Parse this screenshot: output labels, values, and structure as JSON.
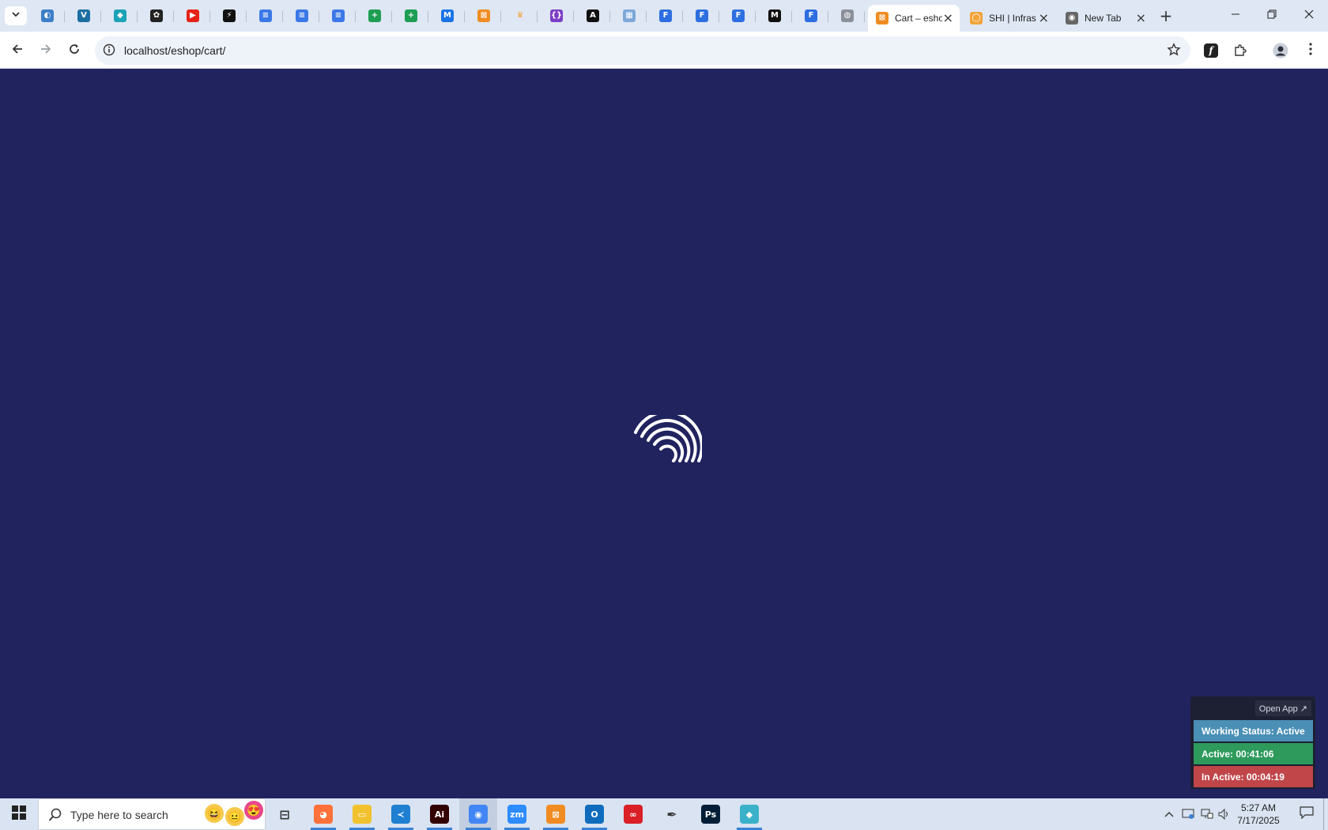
{
  "browser": {
    "pinned_tabs": [
      {
        "icon": "globe-blue-icon",
        "color": "#3d7fc7",
        "glyph": "◐"
      },
      {
        "icon": "shield-v-icon",
        "color": "#1d6fa3",
        "glyph": "V"
      },
      {
        "icon": "cube-teal-icon",
        "color": "#1aa3b5",
        "glyph": "◆"
      },
      {
        "icon": "openai-icon",
        "color": "#222222",
        "glyph": "✿"
      },
      {
        "icon": "youtube-icon",
        "color": "#e62117",
        "glyph": "▶"
      },
      {
        "icon": "bolt-icon",
        "color": "#111111",
        "glyph": "⚡"
      },
      {
        "icon": "docs-icon",
        "color": "#3b78e7",
        "glyph": "≡"
      },
      {
        "icon": "docs-icon",
        "color": "#3b78e7",
        "glyph": "≡"
      },
      {
        "icon": "docs-icon",
        "color": "#3b78e7",
        "glyph": "≡"
      },
      {
        "icon": "sheets-icon",
        "color": "#1e9e52",
        "glyph": "+"
      },
      {
        "icon": "sheets-icon",
        "color": "#1e9e52",
        "glyph": "+"
      },
      {
        "icon": "mq-icon",
        "color": "#1a73e8",
        "glyph": "M"
      },
      {
        "icon": "xampp-icon",
        "color": "#f08c22",
        "glyph": "⊠"
      },
      {
        "icon": "crown-icon",
        "color": "#ffffff",
        "glyph": "♛"
      },
      {
        "icon": "json-icon",
        "color": "#7b3fc4",
        "glyph": "{}"
      },
      {
        "icon": "code-icon",
        "color": "#111111",
        "glyph": "A"
      },
      {
        "icon": "grid-icon",
        "color": "#7da7d9",
        "glyph": "▦"
      },
      {
        "icon": "forms-icon",
        "color": "#2d6ee0",
        "glyph": "F"
      },
      {
        "icon": "forms-icon",
        "color": "#2d6ee0",
        "glyph": "F"
      },
      {
        "icon": "forms-icon",
        "color": "#2d6ee0",
        "glyph": "F"
      },
      {
        "icon": "medium-icon",
        "color": "#111111",
        "glyph": "M"
      },
      {
        "icon": "forms-icon",
        "color": "#2d6ee0",
        "glyph": "F"
      },
      {
        "icon": "globe-grey-icon",
        "color": "#8a8f99",
        "glyph": "◍"
      }
    ],
    "tabs": [
      {
        "title": "Cart – eshop",
        "icon": "xampp-icon",
        "color": "#f08c22",
        "glyph": "⊠",
        "active": true
      },
      {
        "title": "SHI | Infrastructure",
        "icon": "ring-icon",
        "color": "#f2a33a",
        "glyph": "◯",
        "active": false
      },
      {
        "title": "New Tab",
        "icon": "chrome-icon",
        "color": "#666666",
        "glyph": "◉",
        "active": false
      }
    ],
    "new_tab_label": "+",
    "url": "localhost/eshop/cart/"
  },
  "tracker": {
    "open_app_label": "Open App ↗",
    "working_status": "Working Status: Active",
    "active_time": "Active: 00:41:06",
    "inactive_time": "In Active: 00:04:19",
    "colors": {
      "working": "#4a8fb5",
      "active": "#2e9a5c",
      "inactive": "#c0464a"
    }
  },
  "page": {
    "background": "#21235f",
    "loader_icon": "wifi-spinner-icon"
  },
  "taskbar": {
    "search_placeholder": "Type here to search",
    "apps": [
      {
        "name": "task-view",
        "glyph": "⊟",
        "color": "#333333",
        "open": false
      },
      {
        "name": "firefox",
        "glyph": "◕",
        "color": "#ff7139",
        "open": true
      },
      {
        "name": "file-explorer",
        "glyph": "▭",
        "color": "#f2c12e",
        "open": true
      },
      {
        "name": "vscode",
        "glyph": "≺",
        "color": "#1f7fd1",
        "open": true
      },
      {
        "name": "illustrator",
        "glyph": "Ai",
        "color": "#330000",
        "open": true
      },
      {
        "name": "chrome",
        "glyph": "◉",
        "color": "#4285f4",
        "open": true
      },
      {
        "name": "zoom",
        "glyph": "zm",
        "color": "#2d8cff",
        "open": true
      },
      {
        "name": "xampp",
        "glyph": "⊠",
        "color": "#f08c22",
        "open": true
      },
      {
        "name": "outlook",
        "glyph": "O",
        "color": "#0f6cbd",
        "open": true
      },
      {
        "name": "creative-cloud",
        "glyph": "∞",
        "color": "#da1f26",
        "open": false
      },
      {
        "name": "pen-tool",
        "glyph": "✒",
        "color": "#555555",
        "open": false
      },
      {
        "name": "photoshop",
        "glyph": "Ps",
        "color": "#001e36",
        "open": false
      },
      {
        "name": "vpn-app",
        "glyph": "◆",
        "color": "#3bb1c9",
        "open": true
      }
    ],
    "time": "5:27 AM",
    "date": "7/17/2025"
  }
}
